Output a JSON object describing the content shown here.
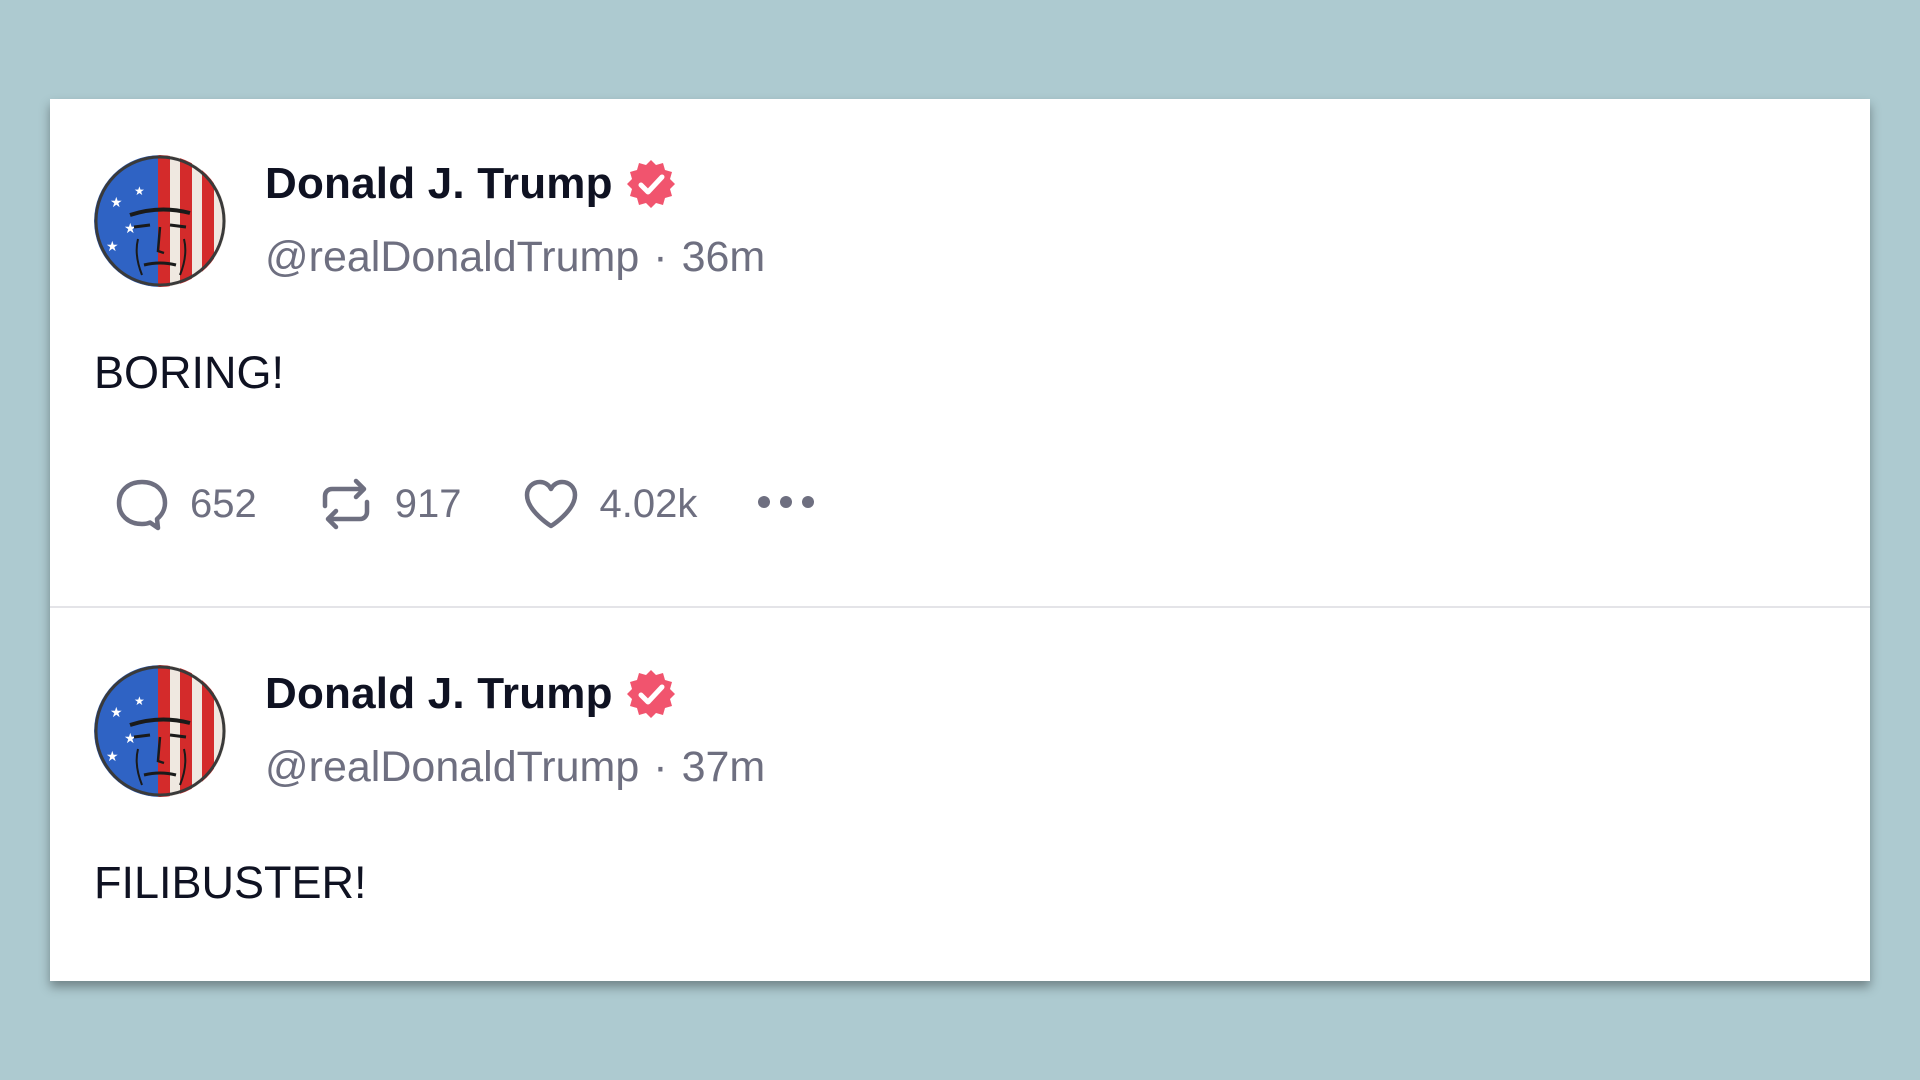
{
  "posts": [
    {
      "author_name": "Donald J. Trump",
      "handle": "@realDonaldTrump",
      "separator": "·",
      "time": "36m",
      "body": "BORING!",
      "replies": "652",
      "reposts": "917",
      "likes": "4.02k"
    },
    {
      "author_name": "Donald J. Trump",
      "handle": "@realDonaldTrump",
      "separator": "·",
      "time": "37m",
      "body": "FILIBUSTER!"
    }
  ],
  "icons": {
    "verified": "verified-badge-icon",
    "reply": "reply-icon",
    "repost": "repost-icon",
    "like": "heart-icon",
    "more": "more-options-icon"
  },
  "colors": {
    "page_background": "#adcad0",
    "verified_badge": "#f1546e",
    "text_primary": "#0f1222",
    "text_secondary": "#6e6f80"
  }
}
